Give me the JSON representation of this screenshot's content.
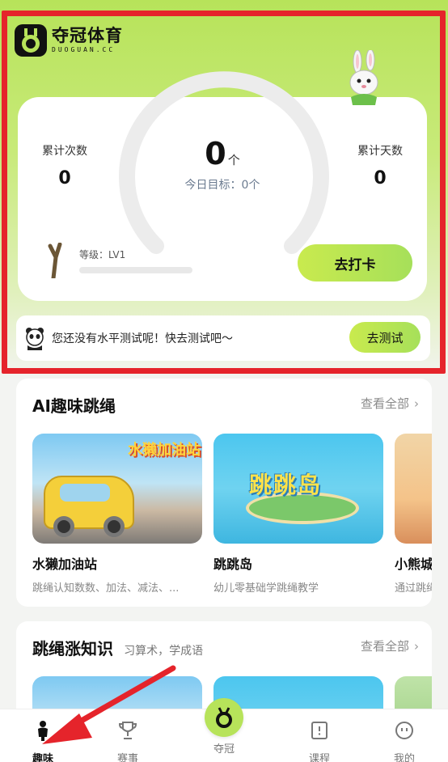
{
  "brand": {
    "name_cn": "夺冠体育",
    "name_en": "DUOGUAN.CC"
  },
  "stats": {
    "cumulative_count_label": "累计次数",
    "cumulative_count_value": "0",
    "cumulative_days_label": "累计天数",
    "cumulative_days_value": "0",
    "today_count": "0",
    "today_unit": "个",
    "today_goal": "今日目标：0个",
    "level": "等级：LV1",
    "checkin_button": "去打卡"
  },
  "test_prompt": {
    "text": "您还没有水平测试呢！快去测试吧～",
    "button": "去测试"
  },
  "sections": [
    {
      "title": "AI趣味跳绳",
      "more": "查看全部",
      "cards": [
        {
          "title": "水獭加油站",
          "desc": "跳绳认知数数、加法、减法、...",
          "thumb_caption": "水獭加油站"
        },
        {
          "title": "跳跳岛",
          "desc": "幼儿零基础学跳绳教学",
          "thumb_caption": "跳跳岛"
        },
        {
          "title": "小熊城",
          "desc": "通过跳绳"
        }
      ]
    },
    {
      "title": "跳绳涨知识",
      "subtitle": "习算术，学成语",
      "more": "查看全部"
    }
  ],
  "tabbar": [
    {
      "label": "趣味",
      "icon": "person-icon",
      "active": true
    },
    {
      "label": "赛事",
      "icon": "trophy-icon"
    },
    {
      "label": "夺冠",
      "icon": "medal-icon"
    },
    {
      "label": "课程",
      "icon": "book-icon"
    },
    {
      "label": "我的",
      "icon": "smiley-icon"
    }
  ],
  "colors": {
    "accent": "#b7e35a",
    "highlight": "#e5242b"
  }
}
